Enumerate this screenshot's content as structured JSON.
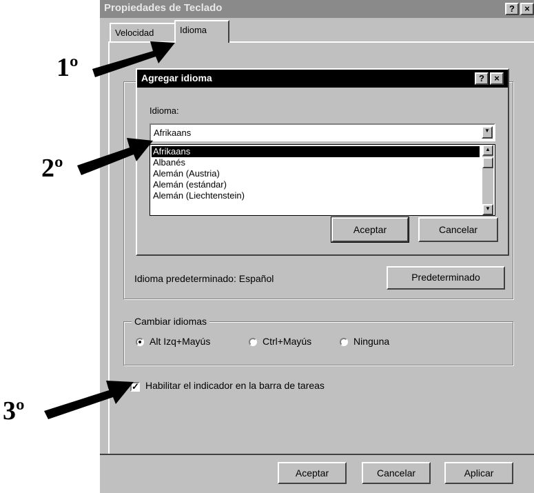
{
  "window": {
    "title": "Propiedades de Teclado",
    "help_button": "?",
    "close_button": "×",
    "tabs": [
      "Velocidad",
      "Idioma"
    ]
  },
  "dialog": {
    "title": "Agregar idioma",
    "help_button": "?",
    "close_button": "×",
    "language_label": "Idioma:",
    "selected_language": "Afrikaans",
    "language_options": [
      "Afrikaans",
      "Albanés",
      "Alemán (Austria)",
      "Alemán (estándar)",
      "Alemán (Liechtenstein)"
    ],
    "accept_button": "Aceptar",
    "cancel_button": "Cancelar"
  },
  "main": {
    "default_language_text": "Idioma predeterminado: Español",
    "set_default_button": "Predeterminado",
    "switch_group_label": "Cambiar idiomas",
    "switch_options": [
      {
        "label": "Alt Izq+Mayús",
        "selected": true
      },
      {
        "label": "Ctrl+Mayús",
        "selected": false
      },
      {
        "label": "Ninguna",
        "selected": false
      }
    ],
    "taskbar_indicator_label": "Habilitar el indicador en la barra de tareas",
    "taskbar_indicator_checked": true
  },
  "footer": {
    "accept_button": "Aceptar",
    "cancel_button": "Cancelar",
    "apply_button": "Aplicar"
  },
  "annotations": {
    "step1": "1º",
    "step2": "2º",
    "step3": "3º"
  },
  "colors": {
    "window_bg": "#c0c0c0",
    "inactive_titlebar": "#8a8a8a",
    "active_titlebar": "#000000",
    "arrow": "#000000"
  }
}
